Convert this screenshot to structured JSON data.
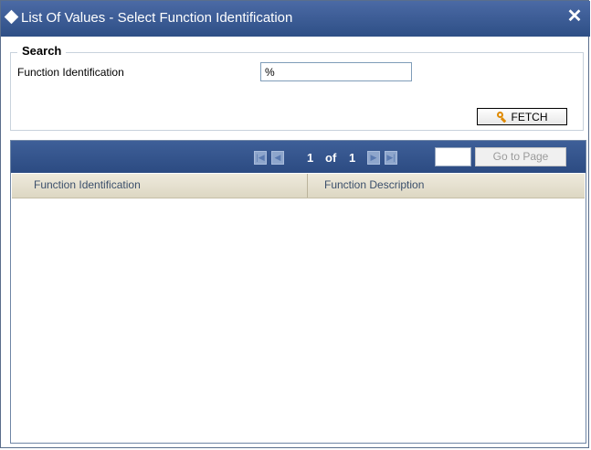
{
  "dialog": {
    "title": "List Of Values - Select Function Identification",
    "close_glyph": "✕"
  },
  "search": {
    "legend": "Search",
    "field_label": "Function Identification",
    "field_value": "%",
    "fetch_label": "FETCH",
    "fetch_icon": "magnifier-icon"
  },
  "pager": {
    "current_page": "1",
    "of_label": "of",
    "total_pages": "1",
    "goto_label": "Go to Page",
    "goto_value": ""
  },
  "table": {
    "columns": [
      "Function Identification",
      "Function Description"
    ],
    "rows": []
  }
}
